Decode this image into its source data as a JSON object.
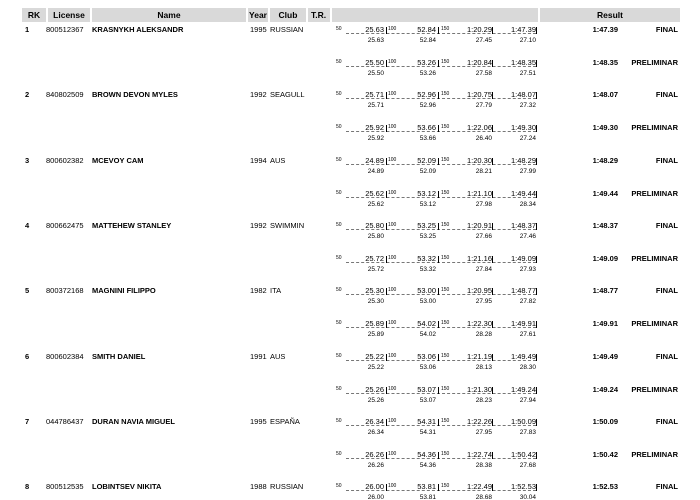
{
  "headers": {
    "rk": "RK",
    "license": "License",
    "name": "Name",
    "year": "Year",
    "club": "Club",
    "tr": "T.R.",
    "result": "Result"
  },
  "split_distances": [
    "50",
    "100",
    "150"
  ],
  "athletes": [
    {
      "rk": "1",
      "license": "800512367",
      "name": "KRASNYKH ALEKSANDR",
      "year": "1995",
      "club": "RUSSIAN",
      "swims": [
        {
          "cum": [
            "25.63",
            "52.84",
            "1:20.29",
            "1:47.39"
          ],
          "lap": [
            "25.63",
            "52.84",
            "27.45",
            "27.10"
          ],
          "result": "1:47.39",
          "stage": "FINAL"
        },
        {
          "cum": [
            "25.50",
            "53.26",
            "1:20.84",
            "1:48.35"
          ],
          "lap": [
            "25.50",
            "53.26",
            "27.58",
            "27.51"
          ],
          "result": "1:48.35",
          "stage": "PRELIMINAR"
        }
      ]
    },
    {
      "rk": "2",
      "license": "840802509",
      "name": "BROWN DEVON MYLES",
      "year": "1992",
      "club": "SEAGULL",
      "swims": [
        {
          "cum": [
            "25.71",
            "52.96",
            "1:20.75",
            "1:48.07"
          ],
          "lap": [
            "25.71",
            "52.96",
            "27.79",
            "27.32"
          ],
          "result": "1:48.07",
          "stage": "FINAL"
        },
        {
          "cum": [
            "25.92",
            "53.66",
            "1:22.06",
            "1:49.30"
          ],
          "lap": [
            "25.92",
            "53.66",
            "26.40",
            "27.24"
          ],
          "result": "1:49.30",
          "stage": "PRELIMINAR"
        }
      ]
    },
    {
      "rk": "3",
      "license": "800602382",
      "name": "MCEVOY CAM",
      "year": "1994",
      "club": "AUS",
      "swims": [
        {
          "cum": [
            "24.89",
            "52.09",
            "1:20.30",
            "1:48.29"
          ],
          "lap": [
            "24.89",
            "52.09",
            "28.21",
            "27.99"
          ],
          "result": "1:48.29",
          "stage": "FINAL"
        },
        {
          "cum": [
            "25.62",
            "53.12",
            "1:21.10",
            "1:49.44"
          ],
          "lap": [
            "25.62",
            "53.12",
            "27.98",
            "28.34"
          ],
          "result": "1:49.44",
          "stage": "PRELIMINAR"
        }
      ]
    },
    {
      "rk": "4",
      "license": "800662475",
      "name": "MATTEHEW STANLEY",
      "year": "1992",
      "club": "SWIMMIN",
      "swims": [
        {
          "cum": [
            "25.80",
            "53.25",
            "1:20.91",
            "1:48.37"
          ],
          "lap": [
            "25.80",
            "53.25",
            "27.66",
            "27.46"
          ],
          "result": "1:48.37",
          "stage": "FINAL"
        },
        {
          "cum": [
            "25.72",
            "53.32",
            "1:21.16",
            "1:49.09"
          ],
          "lap": [
            "25.72",
            "53.32",
            "27.84",
            "27.93"
          ],
          "result": "1:49.09",
          "stage": "PRELIMINAR"
        }
      ]
    },
    {
      "rk": "5",
      "license": "800372168",
      "name": "MAGNINI FILIPPO",
      "year": "1982",
      "club": "ITA",
      "swims": [
        {
          "cum": [
            "25.30",
            "53.00",
            "1:20.95",
            "1:48.77"
          ],
          "lap": [
            "25.30",
            "53.00",
            "27.95",
            "27.82"
          ],
          "result": "1:48.77",
          "stage": "FINAL"
        },
        {
          "cum": [
            "25.89",
            "54.02",
            "1:22.30",
            "1:49.91"
          ],
          "lap": [
            "25.89",
            "54.02",
            "28.28",
            "27.61"
          ],
          "result": "1:49.91",
          "stage": "PRELIMINAR"
        }
      ]
    },
    {
      "rk": "6",
      "license": "800602384",
      "name": "SMITH DANIEL",
      "year": "1991",
      "club": "AUS",
      "swims": [
        {
          "cum": [
            "25.22",
            "53.06",
            "1:21.19",
            "1:49.49"
          ],
          "lap": [
            "25.22",
            "53.06",
            "28.13",
            "28.30"
          ],
          "result": "1:49.49",
          "stage": "FINAL"
        },
        {
          "cum": [
            "25.26",
            "53.07",
            "1:21.30",
            "1:49.24"
          ],
          "lap": [
            "25.26",
            "53.07",
            "28.23",
            "27.94"
          ],
          "result": "1:49.24",
          "stage": "PRELIMINAR"
        }
      ]
    },
    {
      "rk": "7",
      "license": "044786437",
      "name": "DURAN NAVIA MIGUEL",
      "year": "1995",
      "club": "ESPAÑA",
      "swims": [
        {
          "cum": [
            "26.34",
            "54.31",
            "1:22.26",
            "1:50.09"
          ],
          "lap": [
            "26.34",
            "54.31",
            "27.95",
            "27.83"
          ],
          "result": "1:50.09",
          "stage": "FINAL"
        },
        {
          "cum": [
            "26.26",
            "54.36",
            "1:22.74",
            "1:50.42"
          ],
          "lap": [
            "26.26",
            "54.36",
            "28.38",
            "27.68"
          ],
          "result": "1:50.42",
          "stage": "PRELIMINAR"
        }
      ]
    },
    {
      "rk": "8",
      "license": "800512535",
      "name": "LOBINTSEV NIKITA",
      "year": "1988",
      "club": "RUSSIAN",
      "swims": [
        {
          "cum": [
            "26.00",
            "53.81",
            "1:22.49",
            "1:52.53"
          ],
          "lap": [
            "26.00",
            "53.81",
            "28.68",
            "30.04"
          ],
          "result": "1:52.53",
          "stage": "FINAL"
        }
      ]
    }
  ]
}
